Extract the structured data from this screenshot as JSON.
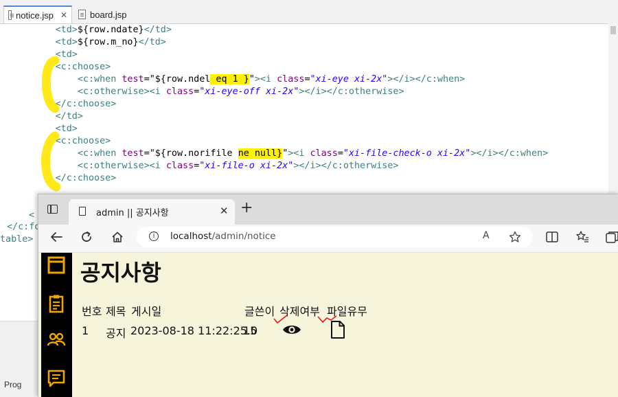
{
  "editor": {
    "tabs": [
      {
        "label": "notice.jsp",
        "close": "✕"
      },
      {
        "label": "board.jsp"
      }
    ],
    "left_stub": [
      "<",
      "</c:fo",
      "table>"
    ],
    "bottom_bar_label": "Prog"
  },
  "browser": {
    "tab_title": "admin || 공지사항",
    "tab_close": "✕",
    "new_tab": "+",
    "address": {
      "host": "localhost",
      "path": "/admin/notice"
    },
    "read_aloud": "A",
    "toolbar_icons": [
      "back-arrow-icon",
      "reload-icon",
      "home-icon",
      "info-icon",
      "read-aloud-icon",
      "favorite-star-icon",
      "split-screen-icon",
      "favorites-icon",
      "collections-icon"
    ]
  },
  "page": {
    "title": "공지사항",
    "sidebar_icons": [
      "window-icon",
      "clipboard-icon",
      "users-icon",
      "message-icon"
    ],
    "sidebar_color": "#f0a500",
    "background": "#f6f5dc",
    "table": {
      "headers": [
        "번호",
        "제목",
        "게시일",
        "글쓴이",
        "삭제여부",
        "파일유무"
      ],
      "rows": [
        {
          "no": "1",
          "title": "공지",
          "date": "2023-08-18 11:22:25.0",
          "writer": "15",
          "deleted_icon": "eye-icon",
          "file_icon": "file-icon"
        }
      ]
    }
  }
}
